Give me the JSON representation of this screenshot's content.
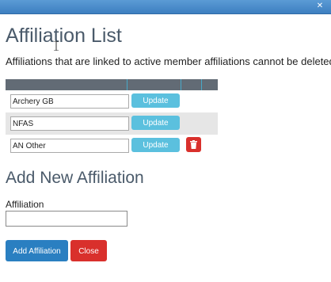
{
  "window": {
    "close_icon": "close-icon",
    "close_glyph": "✕"
  },
  "page": {
    "title": "Affiliation List",
    "subtitle": "Affiliations that are linked to active member affiliations cannot be deleted"
  },
  "affiliations": [
    {
      "name": "Archery GB",
      "update_label": "Update",
      "deletable": false
    },
    {
      "name": "NFAS",
      "update_label": "Update",
      "deletable": false
    },
    {
      "name": "AN Other",
      "update_label": "Update",
      "deletable": true,
      "delete_icon": "trash-icon"
    }
  ],
  "new_affiliation": {
    "heading": "Add New Affiliation",
    "field_label": "Affiliation",
    "value": "",
    "add_label": "Add Affiliation",
    "close_label": "Close"
  },
  "colors": {
    "titlebar": "#3d7fc0",
    "table_header": "#626b75",
    "update_button": "#5bc0de",
    "primary_button": "#2a7fc1",
    "danger_button": "#d9302c",
    "heading_text": "#4a5a6a",
    "alt_row": "#e6e6e6"
  }
}
